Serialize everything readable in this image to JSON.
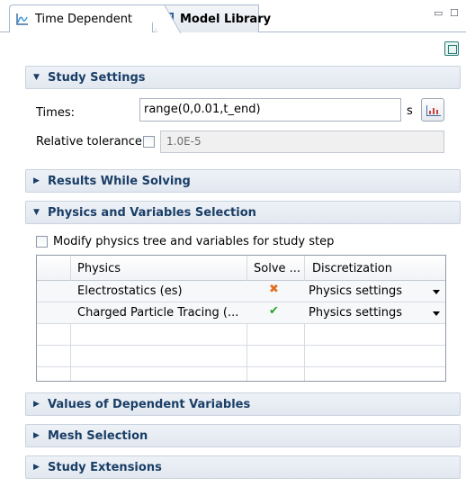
{
  "tabs": [
    {
      "label": "Time Dependent",
      "icon": "time-dependent-icon",
      "active": true
    },
    {
      "label": "Model Library",
      "icon": "model-library-icon",
      "active": false
    }
  ],
  "window_controls": {
    "minimize": "▭",
    "maximize": "☐"
  },
  "sections": {
    "study_settings": {
      "title": "Study Settings",
      "expanded": true,
      "times_label": "Times:",
      "times_value": "range(0,0.01,t_end)",
      "times_unit": "s",
      "reltol_label": "Relative tolerance:",
      "reltol_checked": false,
      "reltol_value": "1.0E-5"
    },
    "results_while_solving": {
      "title": "Results While Solving",
      "expanded": false
    },
    "physics_vars": {
      "title": "Physics and Variables Selection",
      "expanded": true,
      "modify_label": "Modify physics tree and variables for study step",
      "modify_checked": false,
      "columns": [
        "Physics",
        "Solve ...",
        "Discretization"
      ],
      "rows": [
        {
          "physics": "Electrostatics (es)",
          "solve": "x",
          "discretization": "Physics settings"
        },
        {
          "physics": "Charged Particle Tracing (...",
          "solve": "check",
          "discretization": "Physics settings"
        }
      ]
    },
    "values_dependent": {
      "title": "Values of Dependent Variables",
      "expanded": false
    },
    "mesh_selection": {
      "title": "Mesh Selection",
      "expanded": false
    },
    "study_extensions": {
      "title": "Study Extensions",
      "expanded": false
    }
  },
  "colors": {
    "section_title": "#1a3e66",
    "x_mark": "#e07020",
    "check_mark": "#2aa02a"
  }
}
